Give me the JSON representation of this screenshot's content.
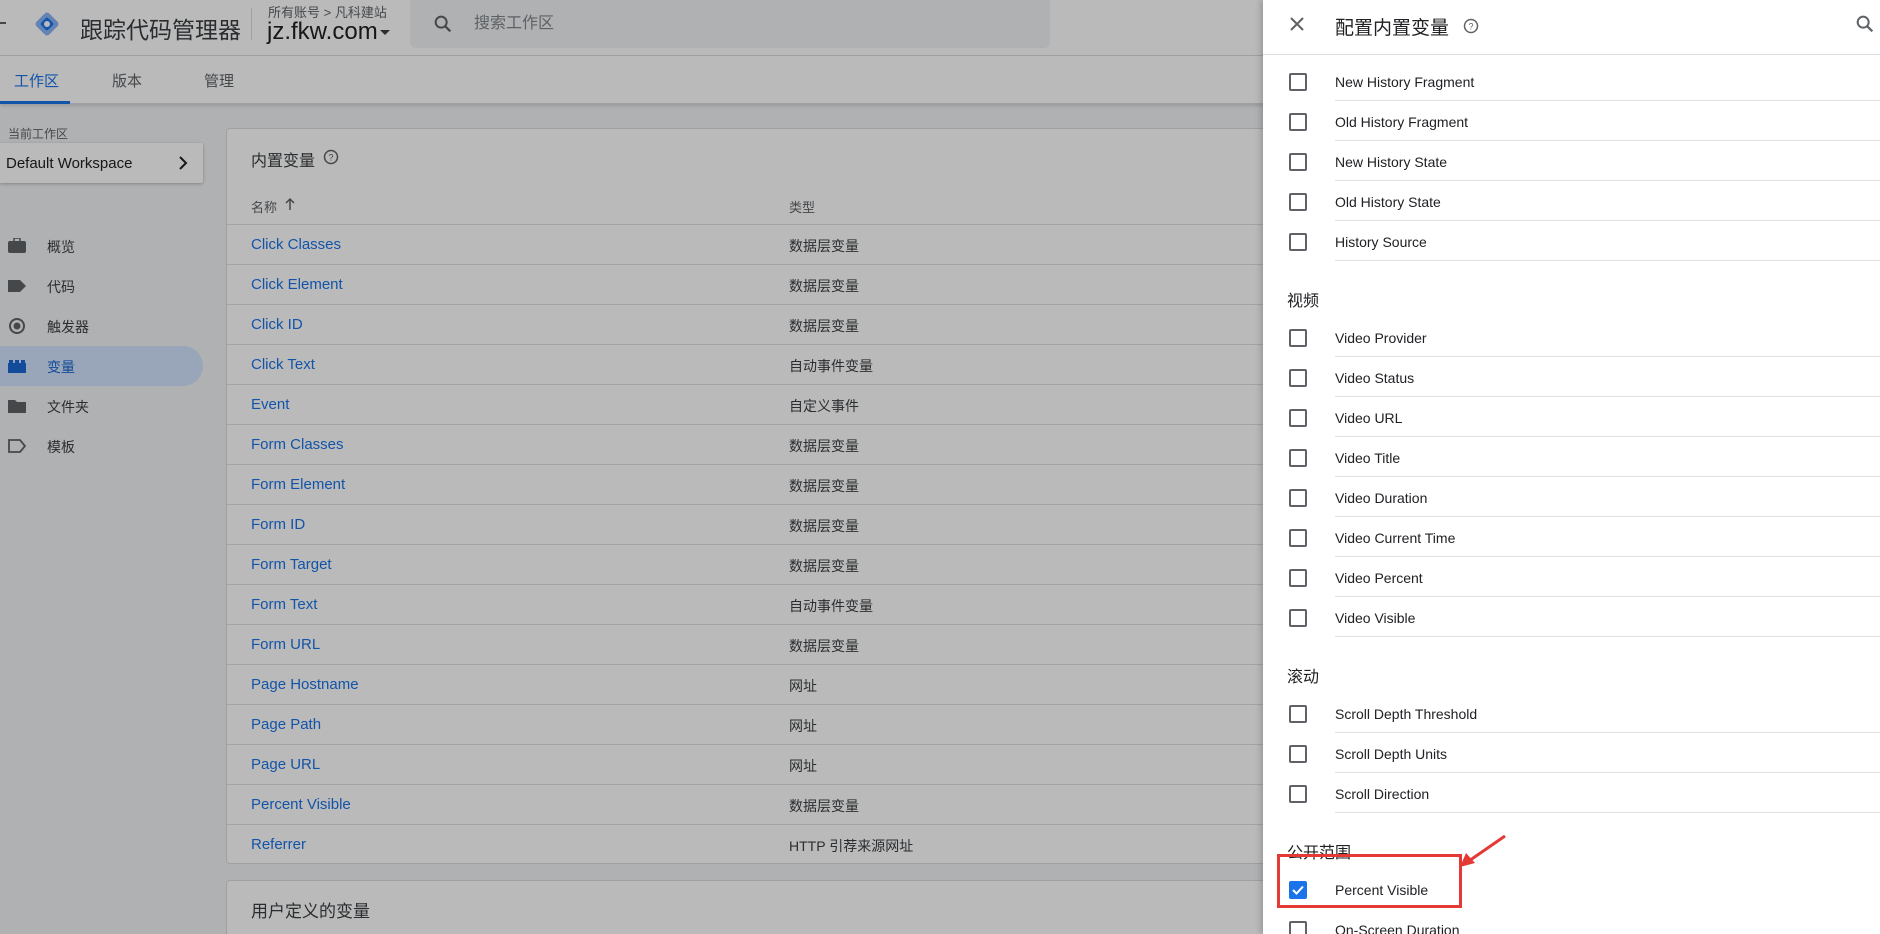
{
  "header": {
    "app_title": "跟踪代码管理器",
    "breadcrumb": "所有账号 > 凡科建站",
    "container": "jz.fkw.com"
  },
  "search": {
    "placeholder": "搜索工作区"
  },
  "tabs": [
    {
      "label": "工作区",
      "active": true
    },
    {
      "label": "版本",
      "active": false
    },
    {
      "label": "管理",
      "active": false
    }
  ],
  "workspace": {
    "label": "当前工作区",
    "name": "Default Workspace"
  },
  "nav": [
    {
      "label": "概览",
      "icon": "briefcase-icon"
    },
    {
      "label": "代码",
      "icon": "tag-icon"
    },
    {
      "label": "触发器",
      "icon": "trigger-icon"
    },
    {
      "label": "变量",
      "icon": "variables-icon",
      "active": true
    },
    {
      "label": "文件夹",
      "icon": "folder-icon"
    },
    {
      "label": "模板",
      "icon": "template-icon"
    }
  ],
  "builtin_table": {
    "title": "内置变量",
    "columns": [
      "名称",
      "类型"
    ],
    "rows": [
      {
        "name": "Click Classes",
        "type": "数据层变量"
      },
      {
        "name": "Click Element",
        "type": "数据层变量"
      },
      {
        "name": "Click ID",
        "type": "数据层变量"
      },
      {
        "name": "Click Text",
        "type": "自动事件变量"
      },
      {
        "name": "Event",
        "type": "自定义事件"
      },
      {
        "name": "Form Classes",
        "type": "数据层变量"
      },
      {
        "name": "Form Element",
        "type": "数据层变量"
      },
      {
        "name": "Form ID",
        "type": "数据层变量"
      },
      {
        "name": "Form Target",
        "type": "数据层变量"
      },
      {
        "name": "Form Text",
        "type": "自动事件变量"
      },
      {
        "name": "Form URL",
        "type": "数据层变量"
      },
      {
        "name": "Page Hostname",
        "type": "网址"
      },
      {
        "name": "Page Path",
        "type": "网址"
      },
      {
        "name": "Page URL",
        "type": "网址"
      },
      {
        "name": "Percent Visible",
        "type": "数据层变量"
      },
      {
        "name": "Referrer",
        "type": "HTTP 引荐来源网址"
      }
    ]
  },
  "user_defined": {
    "title": "用户定义的变量"
  },
  "panel": {
    "title": "配置内置变量",
    "history_items": [
      {
        "label": "New History Fragment",
        "checked": false
      },
      {
        "label": "Old History Fragment",
        "checked": false
      },
      {
        "label": "New History State",
        "checked": false
      },
      {
        "label": "Old History State",
        "checked": false
      },
      {
        "label": "History Source",
        "checked": false
      }
    ],
    "video_section": "视频",
    "video_items": [
      {
        "label": "Video Provider",
        "checked": false
      },
      {
        "label": "Video Status",
        "checked": false
      },
      {
        "label": "Video URL",
        "checked": false
      },
      {
        "label": "Video Title",
        "checked": false
      },
      {
        "label": "Video Duration",
        "checked": false
      },
      {
        "label": "Video Current Time",
        "checked": false
      },
      {
        "label": "Video Percent",
        "checked": false
      },
      {
        "label": "Video Visible",
        "checked": false
      }
    ],
    "scroll_section": "滚动",
    "scroll_items": [
      {
        "label": "Scroll Depth Threshold",
        "checked": false
      },
      {
        "label": "Scroll Depth Units",
        "checked": false
      },
      {
        "label": "Scroll Direction",
        "checked": false
      }
    ],
    "visibility_section": "公开范围",
    "visibility_items": [
      {
        "label": "Percent Visible",
        "checked": true
      },
      {
        "label": "On-Screen Duration",
        "checked": false
      }
    ]
  },
  "colors": {
    "accent": "#1a73e8",
    "annotation": "#e53935"
  }
}
